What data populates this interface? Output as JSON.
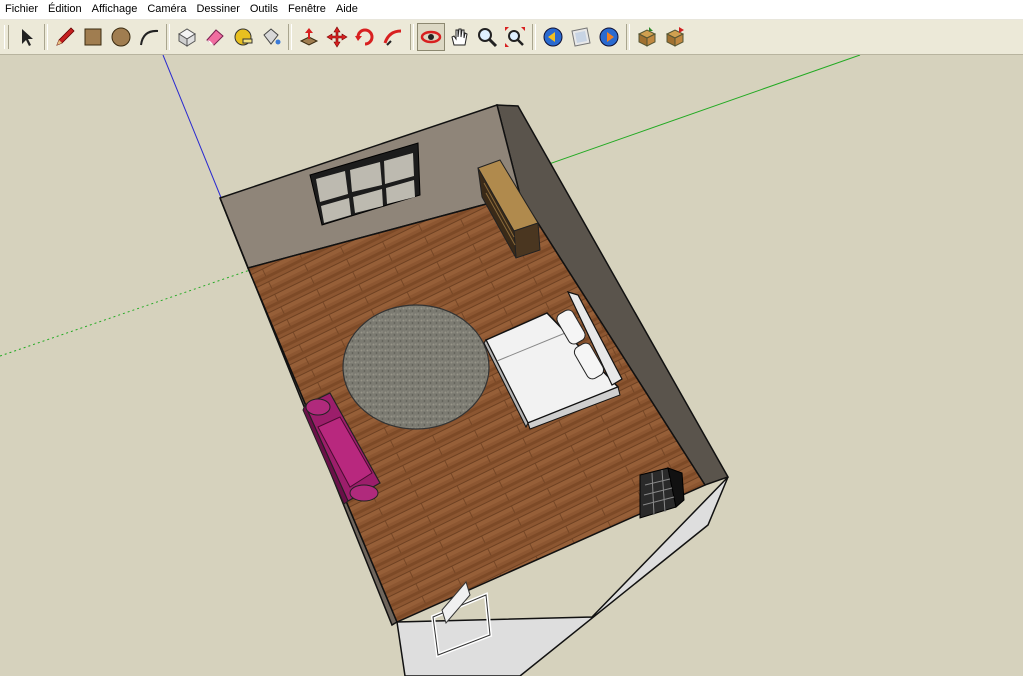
{
  "menu": {
    "items": [
      {
        "id": "fichier",
        "label": "Fichier"
      },
      {
        "id": "edition",
        "label": "Édition"
      },
      {
        "id": "affichage",
        "label": "Affichage"
      },
      {
        "id": "camera",
        "label": "Caméra"
      },
      {
        "id": "dessiner",
        "label": "Dessiner"
      },
      {
        "id": "outils",
        "label": "Outils"
      },
      {
        "id": "fenetre",
        "label": "Fenêtre"
      },
      {
        "id": "aide",
        "label": "Aide"
      }
    ]
  },
  "toolbar": {
    "tools": [
      {
        "id": "select",
        "icon": "arrow-select-icon"
      },
      {
        "id": "line",
        "icon": "pencil-icon"
      },
      {
        "id": "rectangle",
        "icon": "rectangle-icon"
      },
      {
        "id": "circle",
        "icon": "circle-icon"
      },
      {
        "id": "arc",
        "icon": "arc-icon"
      },
      {
        "id": "make-component",
        "icon": "component-icon"
      },
      {
        "id": "eraser",
        "icon": "eraser-icon"
      },
      {
        "id": "tape-measure",
        "icon": "tape-measure-icon"
      },
      {
        "id": "paint-bucket",
        "icon": "paint-bucket-icon"
      },
      {
        "id": "push-pull",
        "icon": "push-pull-icon"
      },
      {
        "id": "move",
        "icon": "move-icon"
      },
      {
        "id": "rotate",
        "icon": "rotate-icon"
      },
      {
        "id": "follow-me",
        "icon": "follow-me-icon"
      },
      {
        "id": "orbit",
        "icon": "orbit-icon"
      },
      {
        "id": "pan",
        "icon": "hand-pan-icon"
      },
      {
        "id": "zoom",
        "icon": "zoom-icon"
      },
      {
        "id": "zoom-extents",
        "icon": "zoom-extents-icon"
      },
      {
        "id": "previous-view",
        "icon": "previous-view-icon"
      },
      {
        "id": "position-camera",
        "icon": "position-camera-icon"
      },
      {
        "id": "next-view",
        "icon": "next-view-icon"
      },
      {
        "id": "get-models",
        "icon": "get-models-icon"
      },
      {
        "id": "share-model",
        "icon": "share-model-icon"
      }
    ],
    "active_tool": "orbit"
  },
  "colors": {
    "background": "#d6d2bd",
    "floor": "#8a5530",
    "back_wall": "#8f8478",
    "right_wall": "#5c554d",
    "front_wall": "#dcdcdc",
    "sofa": "#9a1e6a",
    "rug": "#7b7b72",
    "axis_red": "#cc0000",
    "axis_green": "#22aa22",
    "axis_blue": "#2222cc"
  }
}
